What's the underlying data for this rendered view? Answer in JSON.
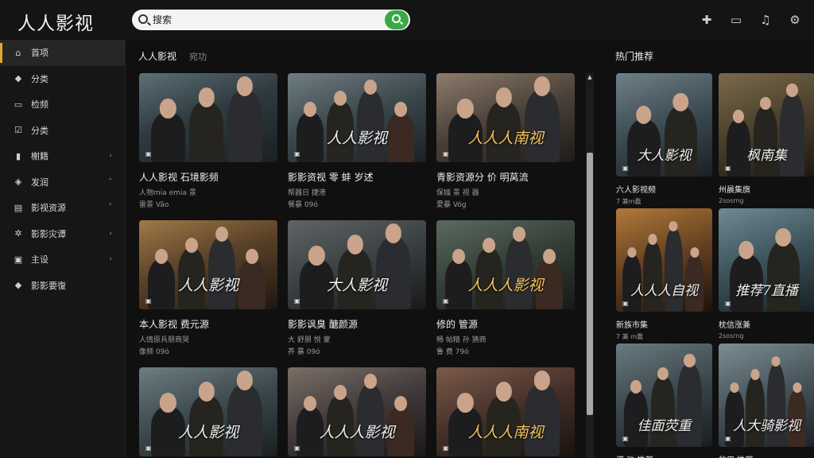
{
  "app": {
    "logo": "人人影视"
  },
  "search": {
    "placeholder": "搜索"
  },
  "top_icons": [
    "puzzle-icon",
    "cast-icon",
    "bell-icon",
    "gear-icon"
  ],
  "sidebar": {
    "items": [
      {
        "label": "首项",
        "icon": "home-icon",
        "glyph": "⌂",
        "chevron": "",
        "active": true
      },
      {
        "label": "分类",
        "icon": "cap-icon",
        "glyph": "◆",
        "chevron": ""
      },
      {
        "label": "检频",
        "icon": "film-icon",
        "glyph": "▭",
        "chevron": ""
      },
      {
        "label": "分类",
        "icon": "checkbox-icon",
        "glyph": "☑",
        "chevron": ""
      },
      {
        "label": "榭籍",
        "icon": "bars-icon",
        "glyph": "▮",
        "chevron": "›"
      },
      {
        "label": "发润",
        "icon": "shield-icon",
        "glyph": "◈",
        "chevron": "˄"
      },
      {
        "label": "影视资源",
        "icon": "chart-icon",
        "glyph": "▤",
        "chevron": "˅"
      },
      {
        "label": "影影灾谭",
        "icon": "gear-icon",
        "glyph": "✲",
        "chevron": "›"
      },
      {
        "label": "主设",
        "icon": "calendar-icon",
        "glyph": "▣",
        "chevron": "›"
      },
      {
        "label": "影影要復",
        "icon": "graduation-icon",
        "glyph": "◆",
        "chevron": ""
      }
    ]
  },
  "tabs": [
    {
      "label": "人人影视"
    },
    {
      "label": "宛功"
    }
  ],
  "grid": [
    {
      "title": "人人影视 石境影频",
      "meta1": "人物mia emia 景",
      "meta2": "雷景 Vão",
      "poster_text": "",
      "gold": false,
      "bg": "linear-gradient(160deg,#5d6f78 0%,#2f3b40 45%,#1a1f22 100%)"
    },
    {
      "title": "影影资视 零 蚌 岁述",
      "meta1": "帮器日 捷港",
      "meta2": "餐暴 09ó",
      "poster_text": "人人影视",
      "gold": false,
      "bg": "linear-gradient(160deg,#6f7e84 0%,#39464a 50%,#1b2124 100%)"
    },
    {
      "title": "青影资源分 价 明莴流",
      "meta1": "保媸 景 视 器",
      "meta2": "愛暴 Vóg",
      "poster_text": "人人人南视",
      "gold": true,
      "bg": "linear-gradient(160deg,#8c7c6c 0%,#4a4038 50%,#1e1b18 100%)"
    },
    {
      "title": "本人影视 费元源",
      "meta1": "人情原兵朋商哭",
      "meta2": "像频 09ó",
      "poster_text": "人人影视",
      "gold": false,
      "bg": "linear-gradient(160deg,#a07a48 0%,#5a4128 45%,#1f1710 100%)"
    },
    {
      "title": "影影讽臭 醣颜源",
      "meta1": "大 舒朋 悦 蒙",
      "meta2": "养 暴 09ó",
      "poster_text": "大人影视",
      "gold": false,
      "bg": "linear-gradient(160deg,#5e6466 0%,#3a3f42 50%,#18191a 100%)"
    },
    {
      "title": "修的 管源",
      "meta1": "畅 帖精 孙 猜商",
      "meta2": "鲁 费 79ó",
      "poster_text": "人人人影视",
      "gold": true,
      "bg": "linear-gradient(160deg,#5a6a60 0%,#333d36 50%,#161a17 100%)"
    },
    {
      "title": "",
      "meta1": "",
      "meta2": "",
      "poster_text": "人人影视",
      "gold": false,
      "bg": "linear-gradient(160deg,#6d7d82 0%,#3a474b 50%,#1a1f21 100%)"
    },
    {
      "title": "",
      "meta1": "",
      "meta2": "",
      "poster_text": "人人人影视",
      "gold": false,
      "bg": "linear-gradient(160deg,#7a6f66 0%,#40393a 50%,#1a1718 100%)"
    },
    {
      "title": "",
      "meta1": "",
      "meta2": "",
      "poster_text": "人人人南视",
      "gold": true,
      "bg": "linear-gradient(160deg,#7a5a4a 0%,#442f28 50%,#1a1210 100%)"
    }
  ],
  "hot": {
    "title": "热门推荐",
    "items": [
      {
        "title": "六人影视频",
        "meta": "7 兼m蠢",
        "poster_text": "大人影视",
        "bg": "linear-gradient(160deg,#6f7f88 0%,#3c4a52 50%,#1a2024 100%)"
      },
      {
        "title": "州晨集旗",
        "meta": "2sosrng",
        "poster_text": "枫南集",
        "bg": "linear-gradient(160deg,#7a6a4c 0%,#4a3f2c 50%,#1d1810 100%)"
      },
      {
        "title": "新族市集",
        "meta": "7 兼 m蠢",
        "poster_text": "人人人自视",
        "bg": "linear-gradient(160deg,#b07a3a 0%,#643f20 50%,#1f130a 100%)"
      },
      {
        "title": "枕信涨兼",
        "meta": "2sosrng",
        "poster_text": "推荐7直播",
        "bg": "linear-gradient(160deg,#6e8a94 0%,#3c525a 50%,#172125 100%)"
      },
      {
        "title": "满 弛 推都",
        "meta": "",
        "poster_text": "佳面荧重",
        "bg": "linear-gradient(160deg,#6a7a80 0%,#3a474c 50%,#181d20 100%)"
      },
      {
        "title": "的用 推都",
        "meta": "",
        "poster_text": "人大骑影视",
        "bg": "linear-gradient(160deg,#7c8c92 0%,#45545a 50%,#1c2326 100%)"
      }
    ]
  }
}
